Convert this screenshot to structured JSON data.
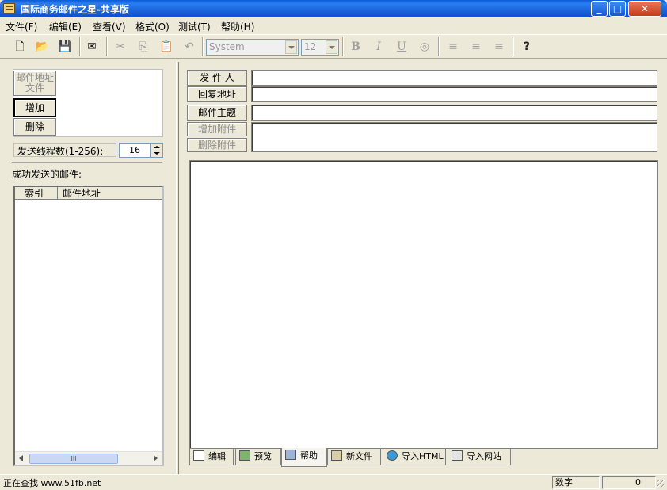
{
  "window": {
    "title": "国际商务邮件之星-共享版",
    "minimize_label": "_",
    "maximize_label": "□",
    "close_label": "✕"
  },
  "menu": [
    {
      "label": "文件(F)"
    },
    {
      "label": "编辑(E)"
    },
    {
      "label": "查看(V)"
    },
    {
      "label": "格式(O)"
    },
    {
      "label": "测试(T)"
    },
    {
      "label": "帮助(H)"
    }
  ],
  "toolbar": {
    "buttons": [
      {
        "icon": "new-document-icon",
        "glyph": "🗋",
        "enabled": true
      },
      {
        "icon": "open-folder-icon",
        "glyph": "📂",
        "enabled": true
      },
      {
        "icon": "save-icon",
        "glyph": "💾",
        "enabled": true
      },
      {
        "icon": "send-icon",
        "glyph": "✉",
        "enabled": true
      },
      {
        "icon": "cut-icon",
        "glyph": "✂",
        "enabled": false
      },
      {
        "icon": "copy-icon",
        "glyph": "⎘",
        "enabled": false
      },
      {
        "icon": "paste-icon",
        "glyph": "📋",
        "enabled": false
      },
      {
        "icon": "undo-icon",
        "glyph": "↶",
        "enabled": false
      },
      {
        "icon": "bold-icon",
        "glyph": "B",
        "enabled": false
      },
      {
        "icon": "italic-icon",
        "glyph": "I",
        "enabled": false
      },
      {
        "icon": "underline-icon",
        "glyph": "U",
        "enabled": false
      },
      {
        "icon": "color-palette-icon",
        "glyph": "◎",
        "enabled": false
      },
      {
        "icon": "align-left-icon",
        "glyph": "≡",
        "enabled": false
      },
      {
        "icon": "align-center-icon",
        "glyph": "≡",
        "enabled": false
      },
      {
        "icon": "align-right-icon",
        "glyph": "≡",
        "enabled": false
      },
      {
        "icon": "help-icon",
        "glyph": "?",
        "enabled": true
      }
    ],
    "font_name": "System",
    "font_size": "12"
  },
  "left": {
    "addr_file_label": "邮件地址文件",
    "add_label": "增加",
    "delete_label": "删除",
    "thread_label": "发送线程数(1-256):",
    "thread_value": "16",
    "sent_label": "成功发送的邮件:",
    "columns": [
      "索引",
      "邮件地址"
    ],
    "scroll_thumb": "III"
  },
  "header_fields": {
    "from_label": "发 件 人",
    "reply_label": "回复地址",
    "subject_label": "邮件主题",
    "add_attach_label": "增加附件",
    "del_attach_label": "删除附件"
  },
  "tabs": [
    {
      "label": "编辑",
      "icon": "edit-icon"
    },
    {
      "label": "预览",
      "icon": "preview-icon"
    },
    {
      "label": "帮助",
      "icon": "help-book-icon"
    },
    {
      "label": "新文件",
      "icon": "new-file-icon"
    },
    {
      "label": "导入HTML",
      "icon": "import-html-icon"
    },
    {
      "label": "导入网站",
      "icon": "import-website-icon"
    }
  ],
  "status": {
    "text": "正在查找 www.51fb.net",
    "mode": "数字",
    "count": "0"
  }
}
